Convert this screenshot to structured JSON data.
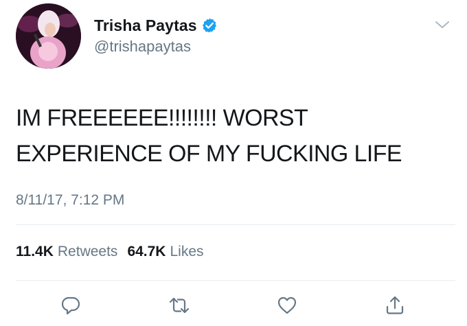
{
  "user": {
    "display_name": "Trisha Paytas",
    "handle": "@trishapaytas",
    "verified": true
  },
  "tweet": {
    "text": "IM FREEEEEE!!!!!!!! WORST\nEXPERIENCE OF MY FUCKING LIFE",
    "timestamp": "8/11/17, 7:12 PM"
  },
  "stats": {
    "retweets_count": "11.4K",
    "retweets_label": "Retweets",
    "likes_count": "64.7K",
    "likes_label": "Likes"
  },
  "icons": {
    "verified": "verified-badge-icon",
    "caret": "chevron-down-icon",
    "reply": "reply-icon",
    "retweet": "retweet-icon",
    "like": "heart-icon",
    "share": "share-icon"
  },
  "colors": {
    "text_primary": "#14171a",
    "text_secondary": "#657786",
    "verified_blue": "#1da1f2",
    "divider": "#e6ecf0"
  }
}
